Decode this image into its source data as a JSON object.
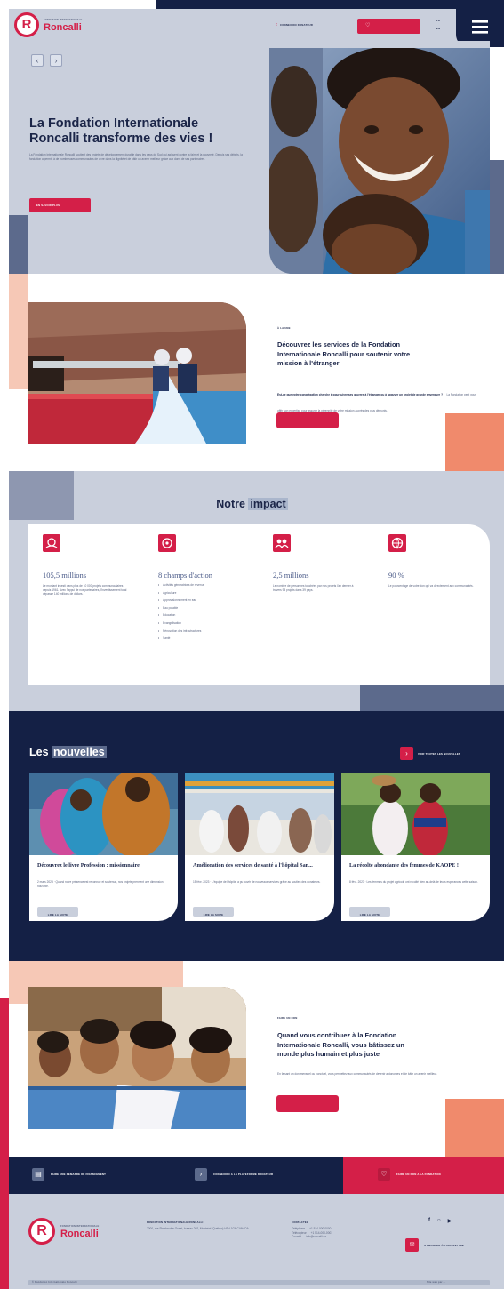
{
  "header": {
    "logo_letter": "R",
    "logo_small": "FONDATION INTERNATIONALE",
    "logo_name": "Roncalli",
    "donor_link": "CONNEXION DONATEUR",
    "donate_button": "",
    "lang": "FR",
    "lang_alt": "EN"
  },
  "hero": {
    "title_line1": "La Fondation Internationale",
    "title_line2": "Roncalli transforme des vies !",
    "paragraph": "La Fondation Internationale Roncalli soutient des projets de développement durable dans les pays du Sud qui agissent contre la faim et la pauvreté. Depuis ses débuts, la fondation a permis à de nombreuses communautés de vivre dans la dignité et de bâtir un avenir meilleur grâce aux dons de ses partenaires.",
    "button": "EN SAVOIR PLUS"
  },
  "services": {
    "kicker": "À LA UNE",
    "title_line1": "Découvrez les services de la Fondation",
    "title_line2": "Internationale Roncalli pour soutenir votre",
    "title_line3": "mission à l'étranger",
    "paragraph_bold": "Est-ce que votre congrégation cherche à poursuivre ses œuvres à l'étranger ou à appuyer un projet de grande envergure ?",
    "paragraph": "La Fondation peut vous offrir son expertise pour assurer la pérennité de votre mission auprès des plus démunis.",
    "button": ""
  },
  "impact": {
    "title_plain": "Notre",
    "title_highlight": "impact",
    "stats": [
      {
        "value": "105,5 millions",
        "text": "Le montant investi dans plus de 10 000 projets communautaires depuis 1961. Avec l'appui de nos partenaires, l'investissement total dépasse 140 millions de dollars."
      },
      {
        "value": "8 champs d'action",
        "text": ""
      },
      {
        "value": "2,5 millions",
        "text": "Le nombre de personnes touchées par nos projets l'an dernier à travers 98 projets dans 39 pays."
      },
      {
        "value": "90 %",
        "text": "Le pourcentage de votre don qui va directement aux communautés."
      }
    ],
    "fields": [
      "Activités génératrices de revenus",
      "Agriculture",
      "Approvisionnement en eau",
      "Eau potable",
      "Éducation",
      "Évangélisation",
      "Rénovation des infrastructures",
      "Santé"
    ]
  },
  "news": {
    "title_plain": "Les",
    "title_highlight": "nouvelles",
    "see_all": "VOIR TOUTES LES NOUVELLES",
    "items": [
      {
        "title": "Découvrez le livre Profession : missionnaire",
        "excerpt": "2 mars 2023 · Quand notre présence est reconnue et soutenue, nos projets prennent une dimension nouvelle.",
        "button": "LIRE LA SUITE"
      },
      {
        "title": "Amélioration des services de santé à l'hôpital San...",
        "excerpt": "15 févr. 2023 · L'équipe de l'hôpital a pu ouvrir de nouveaux services grâce au soutien des donateurs.",
        "button": "LIRE LA SUITE"
      },
      {
        "title": "La récolte abondante des femmes de KAOPE !",
        "excerpt": "8 févr. 2023 · Les femmes du projet agricole ont récolté bien au-delà de leurs espérances cette saison.",
        "button": "LIRE LA SUITE"
      }
    ]
  },
  "contribute": {
    "kicker": "FAIRE UN DON",
    "title_line1": "Quand vous contribuez à la Fondation",
    "title_line2": "Internationale Roncalli, vous bâtissez un",
    "title_line3": "monde plus humain et plus juste",
    "paragraph": "En faisant un don mensuel ou ponctuel, vous permettez aux communautés de devenir autonomes et de bâtir un avenir meilleur.",
    "button": ""
  },
  "cta_bar": [
    {
      "label": "FAIRE UNE DEMANDE DE FINANCEMENT"
    },
    {
      "label": "CONNEXION À LA PLATEFORME DONATEUR"
    },
    {
      "label": "FAIRE UN DON À LA FONDATION"
    }
  ],
  "footer": {
    "org_name": "FONDATION INTERNATIONALE RONCALLI",
    "address": "2000, rue Sherbrooke Ouest, bureau 202, Montréal (Québec) H3H 1G6 CANADA",
    "contact_title": "CONTACTEZ",
    "phone_label": "Téléphone",
    "phone": "+1 514-000-0000",
    "fax_label": "Télécopieur",
    "fax": "+1 514-000-0001",
    "email_label": "Courriel",
    "email": "info@roncalli.ca",
    "newsletter": "S'ABONNER À L'INFOLETTRE",
    "copyright": "© Fondation Internationale Roncalli",
    "credit": "Site web par ..."
  },
  "colors": {
    "navy": "#142045",
    "red": "#d41f48",
    "grey": "#c9cfdc",
    "peach": "#f6c8b6",
    "salmon": "#f08a6c",
    "slate": "#5c6a8c"
  }
}
